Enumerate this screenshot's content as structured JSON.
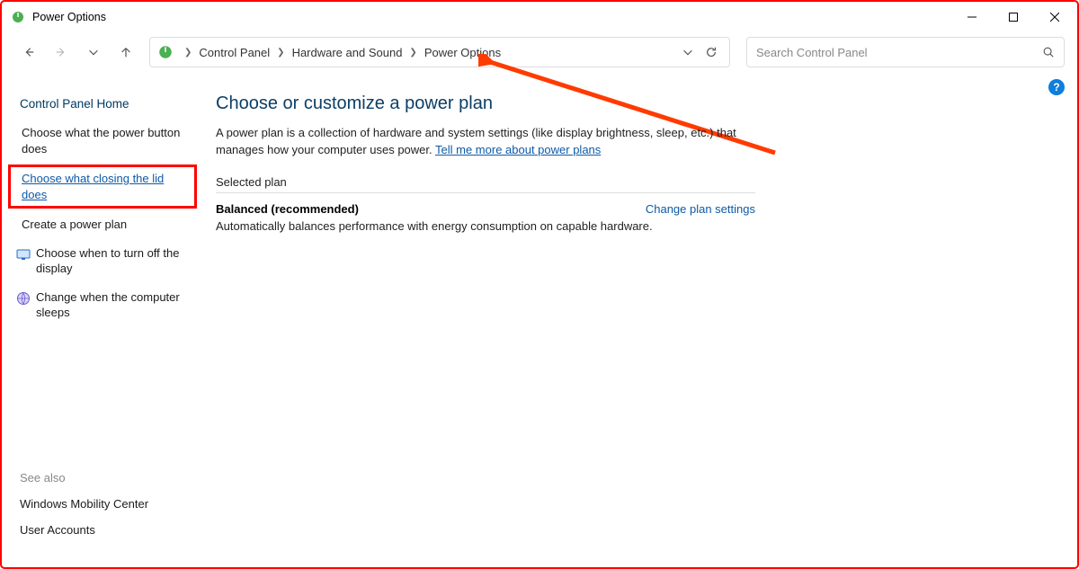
{
  "window": {
    "title": "Power Options"
  },
  "breadcrumb": {
    "items": [
      "Control Panel",
      "Hardware and Sound",
      "Power Options"
    ]
  },
  "search": {
    "placeholder": "Search Control Panel"
  },
  "sidebar": {
    "home": "Control Panel Home",
    "links": [
      {
        "label": "Choose what the power button does"
      },
      {
        "label": "Choose what closing the lid does",
        "highlight": true
      },
      {
        "label": "Create a power plan"
      },
      {
        "label": "Choose when to turn off the display",
        "icon": "display-icon"
      },
      {
        "label": "Change when the computer sleeps",
        "icon": "globe-icon"
      }
    ],
    "see_also_label": "See also",
    "see_also": [
      "Windows Mobility Center",
      "User Accounts"
    ]
  },
  "main": {
    "heading": "Choose or customize a power plan",
    "desc_prefix": "A power plan is a collection of hardware and system settings (like display brightness, sleep, etc.) that manages how your computer uses power. ",
    "desc_link": "Tell me more about power plans",
    "section": "Selected plan",
    "plan_name": "Balanced (recommended)",
    "plan_link": "Change plan settings",
    "plan_desc": "Automatically balances performance with energy consumption on capable hardware."
  },
  "help_badge": "?"
}
